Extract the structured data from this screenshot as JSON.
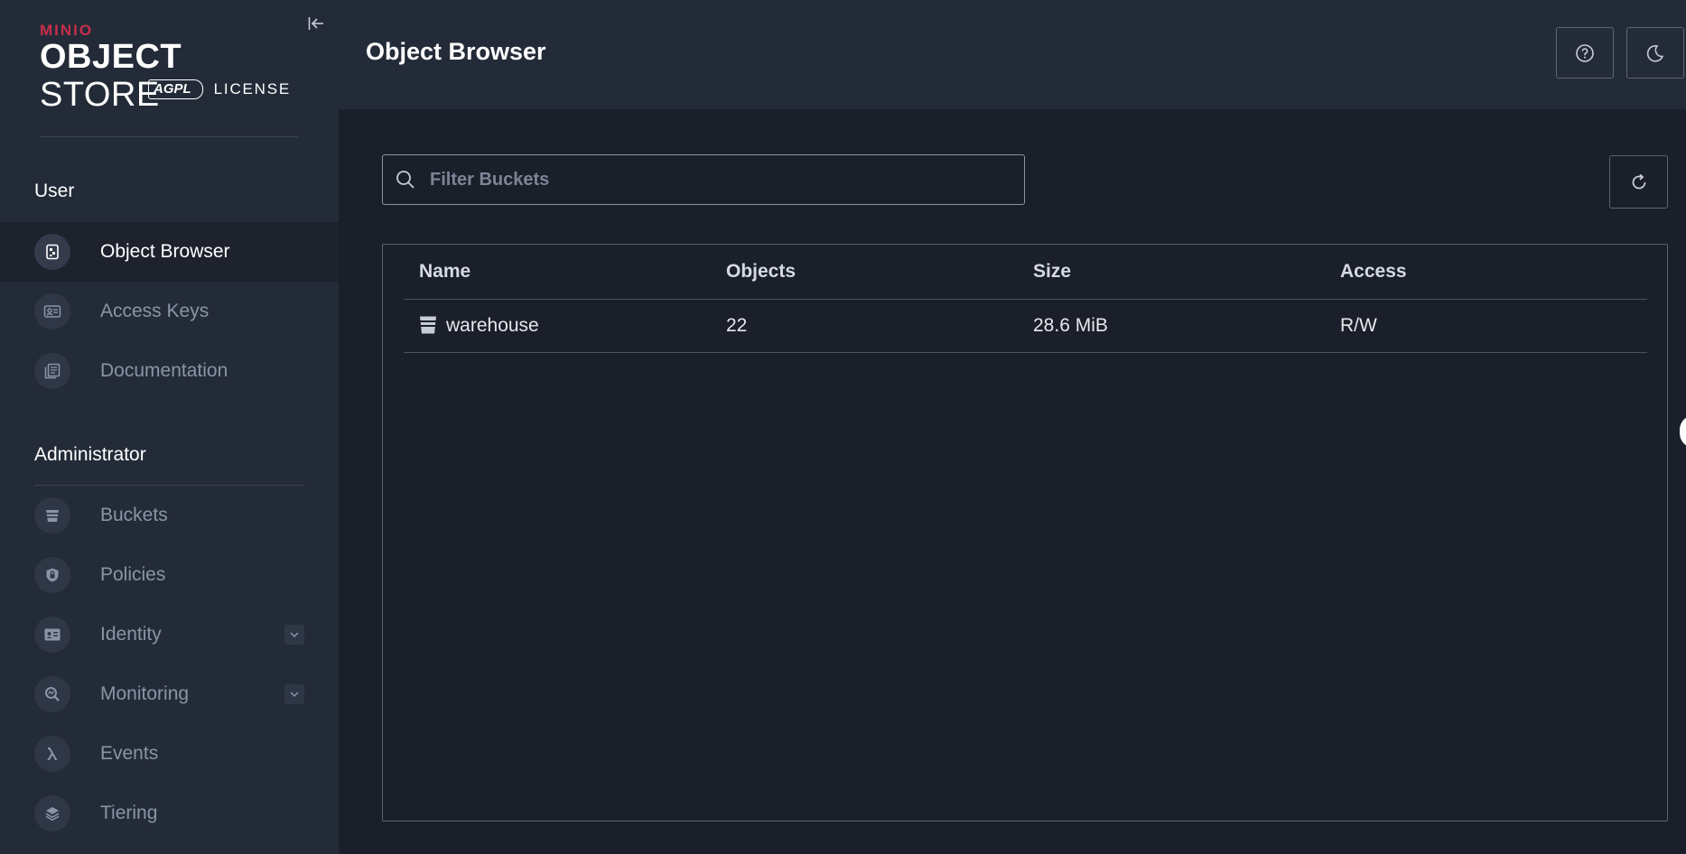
{
  "logo": {
    "brand": "MINIO",
    "product_bold": "OBJECT",
    "product_light": "STORE",
    "badge": "AGPL",
    "license": "LICENSE"
  },
  "sidebar": {
    "user_section": "User",
    "user_items": [
      {
        "label": "Object Browser",
        "icon": "object-browser-icon",
        "active": true
      },
      {
        "label": "Access Keys",
        "icon": "access-keys-icon"
      },
      {
        "label": "Documentation",
        "icon": "documentation-icon"
      }
    ],
    "admin_section": "Administrator",
    "admin_items": [
      {
        "label": "Buckets",
        "icon": "bucket-icon"
      },
      {
        "label": "Policies",
        "icon": "shield-icon"
      },
      {
        "label": "Identity",
        "icon": "identity-card-icon",
        "expandable": true
      },
      {
        "label": "Monitoring",
        "icon": "monitoring-icon",
        "expandable": true
      },
      {
        "label": "Events",
        "icon": "lambda-icon"
      },
      {
        "label": "Tiering",
        "icon": "layers-icon"
      }
    ]
  },
  "header": {
    "title": "Object Browser",
    "help_icon": "help-icon",
    "theme_icon": "moon-icon"
  },
  "main": {
    "filter": {
      "placeholder": "Filter Buckets",
      "value": ""
    },
    "table": {
      "columns": [
        "Name",
        "Objects",
        "Size",
        "Access"
      ],
      "rows": [
        {
          "name": "warehouse",
          "objects": "22",
          "size": "28.6 MiB",
          "access": "R/W"
        }
      ]
    }
  },
  "colors": {
    "sidebar_bg": "#242b38",
    "content_bg": "#1a1f2a",
    "brand_red": "#c72e49"
  }
}
